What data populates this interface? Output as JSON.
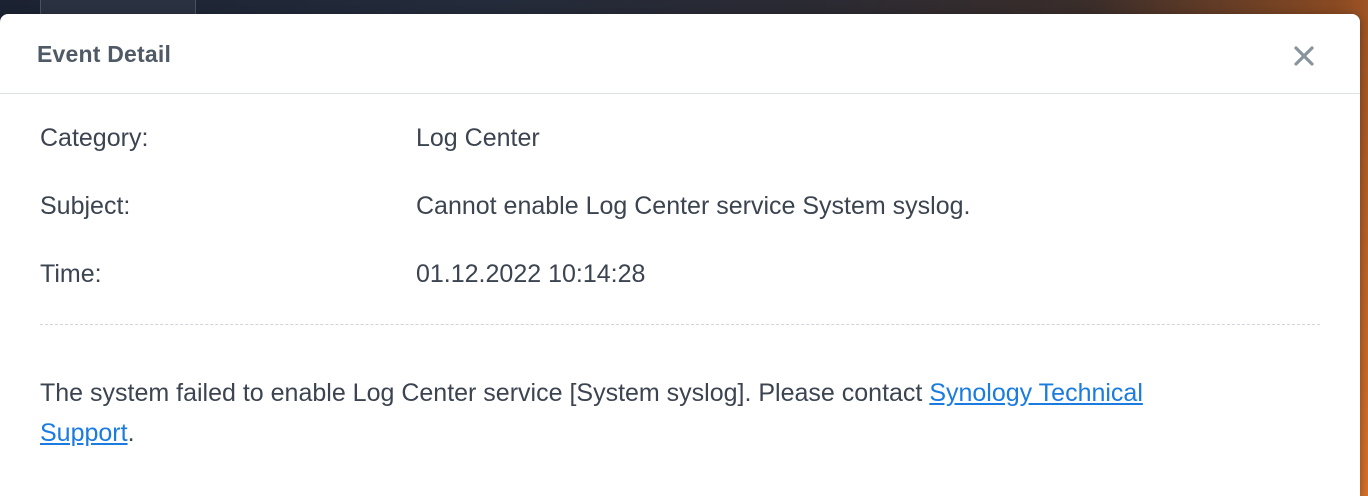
{
  "dialog": {
    "title": "Event Detail",
    "close_icon": "close-icon"
  },
  "fields": [
    {
      "label": "Category:",
      "value": "Log Center"
    },
    {
      "label": "Subject:",
      "value": "Cannot enable Log Center service System syslog."
    },
    {
      "label": "Time:",
      "value": "01.12.2022 10:14:28"
    }
  ],
  "description": {
    "text_before": "The system failed to enable Log Center service [System syslog]. Please contact ",
    "link_text": "Synology Technical Support",
    "text_after": "."
  },
  "colors": {
    "link": "#1a7be0",
    "title": "#4f5a66",
    "text": "#3b4450"
  }
}
